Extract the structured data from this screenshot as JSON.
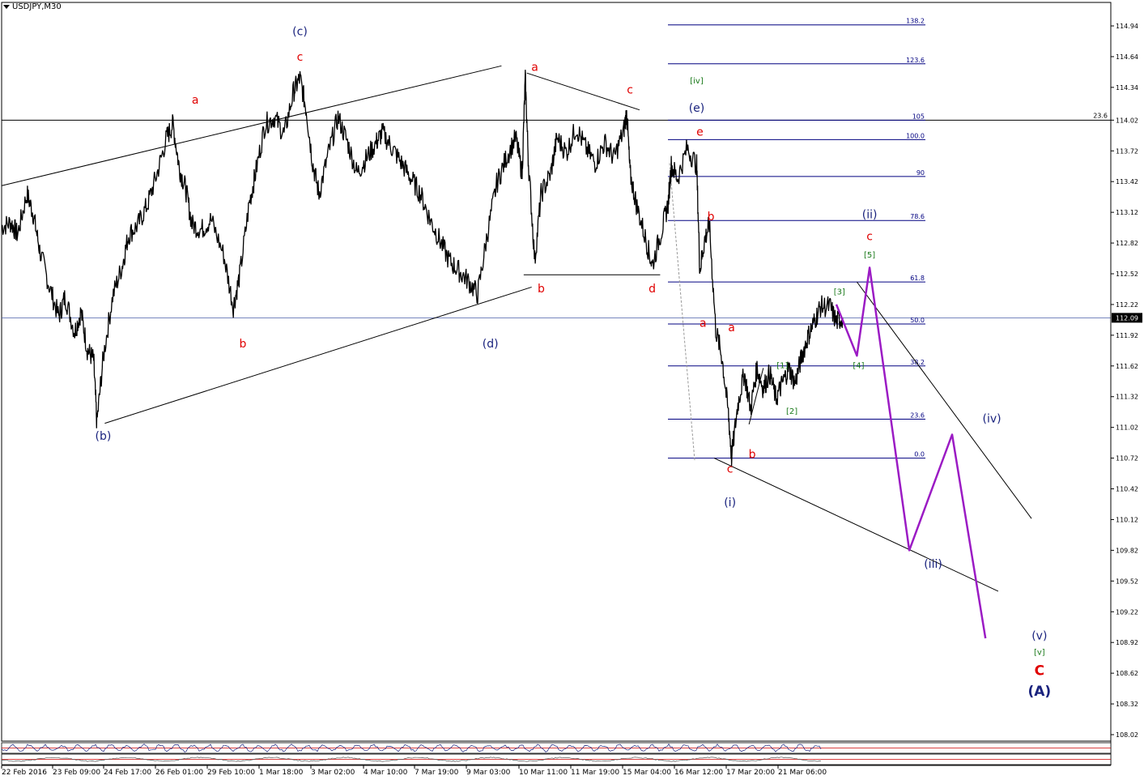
{
  "symbol": "USDJPY,M30",
  "colors": {
    "price": "#000000",
    "fib": "#000080",
    "projection": "#9b1bc4",
    "red_label": "#e00000",
    "blue_label": "#1a237e",
    "green_label": "#1b7a1b",
    "current_line": "#4a5fa8"
  },
  "chart_data": {
    "type": "line",
    "instrument": "USDJPY",
    "timeframe": "M30",
    "ylim": [
      108.02,
      115.0
    ],
    "yticks": [
      114.94,
      114.64,
      114.34,
      114.02,
      113.72,
      113.42,
      113.12,
      112.82,
      112.52,
      112.22,
      111.92,
      111.62,
      111.32,
      111.02,
      110.72,
      110.42,
      110.12,
      109.82,
      109.52,
      109.22,
      108.92,
      108.62,
      108.32,
      108.02
    ],
    "xticks": [
      "22 Feb 2016",
      "23 Feb 09:00",
      "24 Feb 17:00",
      "26 Feb 01:00",
      "29 Feb 10:00",
      "1 Mar 18:00",
      "3 Mar 02:00",
      "4 Mar 10:00",
      "7 Mar 19:00",
      "9 Mar 03:00",
      "10 Mar 11:00",
      "11 Mar 19:00",
      "15 Mar 04:00",
      "16 Mar 12:00",
      "17 Mar 20:00",
      "21 Mar 06:00"
    ],
    "price_path": [
      [
        0,
        112.98
      ],
      [
        0.3,
        113.02
      ],
      [
        0.5,
        112.9
      ],
      [
        0.8,
        113.3
      ],
      [
        1.0,
        113.1
      ],
      [
        1.2,
        112.75
      ],
      [
        1.5,
        112.4
      ],
      [
        1.8,
        112.1
      ],
      [
        2.0,
        112.3
      ],
      [
        2.3,
        111.95
      ],
      [
        2.5,
        112.15
      ],
      [
        2.7,
        111.78
      ],
      [
        2.9,
        111.68
      ],
      [
        3.0,
        111.06
      ],
      [
        3.2,
        111.7
      ],
      [
        3.5,
        112.3
      ],
      [
        3.8,
        112.6
      ],
      [
        4.0,
        112.9
      ],
      [
        4.3,
        113.0
      ],
      [
        4.6,
        113.2
      ],
      [
        4.9,
        113.5
      ],
      [
        5.2,
        113.85
      ],
      [
        5.4,
        113.98
      ],
      [
        5.6,
        113.55
      ],
      [
        5.8,
        113.35
      ],
      [
        6.0,
        113.0
      ],
      [
        6.3,
        112.95
      ],
      [
        6.6,
        113.05
      ],
      [
        7.0,
        112.7
      ],
      [
        7.3,
        112.2
      ],
      [
        7.5,
        112.5
      ],
      [
        7.8,
        113.2
      ],
      [
        8.0,
        113.5
      ],
      [
        8.3,
        113.98
      ],
      [
        8.6,
        114.05
      ],
      [
        8.9,
        113.88
      ],
      [
        9.2,
        114.3
      ],
      [
        9.4,
        114.43
      ],
      [
        9.6,
        114.12
      ],
      [
        9.8,
        113.6
      ],
      [
        10.0,
        113.3
      ],
      [
        10.3,
        113.7
      ],
      [
        10.6,
        114.05
      ],
      [
        10.9,
        113.8
      ],
      [
        11.2,
        113.5
      ],
      [
        11.5,
        113.65
      ],
      [
        11.8,
        113.8
      ],
      [
        12.0,
        113.9
      ],
      [
        12.3,
        113.75
      ],
      [
        12.6,
        113.6
      ],
      [
        12.9,
        113.45
      ],
      [
        13.2,
        113.3
      ],
      [
        13.5,
        113.05
      ],
      [
        13.8,
        112.85
      ],
      [
        14.1,
        112.65
      ],
      [
        14.4,
        112.55
      ],
      [
        14.7,
        112.45
      ],
      [
        15.0,
        112.32
      ],
      [
        15.3,
        112.9
      ],
      [
        15.6,
        113.4
      ],
      [
        15.9,
        113.65
      ],
      [
        16.2,
        113.85
      ],
      [
        16.4,
        113.5
      ],
      [
        16.5,
        114.42
      ],
      [
        16.6,
        113.6
      ],
      [
        16.8,
        112.65
      ],
      [
        17.0,
        113.3
      ],
      [
        17.3,
        113.5
      ],
      [
        17.5,
        113.85
      ],
      [
        17.8,
        113.7
      ],
      [
        18.1,
        113.95
      ],
      [
        18.4,
        113.75
      ],
      [
        18.7,
        113.6
      ],
      [
        19.0,
        113.8
      ],
      [
        19.3,
        113.65
      ],
      [
        19.6,
        113.92
      ],
      [
        19.7,
        114.1
      ],
      [
        19.8,
        113.5
      ],
      [
        20.0,
        113.2
      ],
      [
        20.3,
        112.85
      ],
      [
        20.5,
        112.6
      ],
      [
        20.8,
        112.95
      ],
      [
        21.0,
        113.2
      ],
      [
        21.1,
        113.58
      ],
      [
        21.3,
        113.45
      ],
      [
        21.6,
        113.75
      ],
      [
        21.9,
        113.58
      ],
      [
        22.0,
        112.55
      ],
      [
        22.15,
        112.85
      ],
      [
        22.3,
        113.0
      ],
      [
        22.5,
        111.98
      ],
      [
        22.7,
        111.7
      ],
      [
        22.9,
        111.15
      ],
      [
        23.0,
        110.73
      ],
      [
        23.2,
        111.25
      ],
      [
        23.4,
        111.55
      ],
      [
        23.6,
        111.2
      ],
      [
        23.8,
        111.6
      ],
      [
        24.0,
        111.4
      ],
      [
        24.2,
        111.55
      ],
      [
        24.4,
        111.3
      ],
      [
        24.6,
        111.45
      ],
      [
        24.8,
        111.6
      ],
      [
        25.0,
        111.45
      ],
      [
        25.2,
        111.7
      ],
      [
        25.4,
        111.9
      ],
      [
        25.6,
        112.05
      ],
      [
        25.8,
        112.2
      ],
      [
        26.1,
        112.2
      ],
      [
        26.3,
        112.05
      ],
      [
        26.5,
        112.09
      ]
    ],
    "fibonacci": [
      {
        "label": "138.2",
        "price": 114.95
      },
      {
        "label": "123.6",
        "price": 114.57
      },
      {
        "label": "105",
        "price": 114.02
      },
      {
        "label": "100.0",
        "price": 113.83
      },
      {
        "label": "90",
        "price": 113.47
      },
      {
        "label": "78.6",
        "price": 113.04
      },
      {
        "label": "61.8",
        "price": 112.44
      },
      {
        "label": "50.0",
        "price": 112.03
      },
      {
        "label": "38.2",
        "price": 111.62
      },
      {
        "label": "23.6",
        "price": 111.1
      },
      {
        "label": "0.0",
        "price": 110.72
      }
    ],
    "level_line": {
      "price": 114.02,
      "label": "23.6"
    },
    "current_price": {
      "label": "112.09",
      "price": 112.09
    },
    "projection_path": [
      [
        26.3,
        112.22
      ],
      [
        26.95,
        111.72
      ],
      [
        27.35,
        112.58
      ],
      [
        28.6,
        109.82
      ],
      [
        29.95,
        110.95
      ],
      [
        31.0,
        108.96
      ]
    ],
    "wave_labels": [
      {
        "text": "(c)",
        "x": 9.4,
        "y": 114.85,
        "color": "blue"
      },
      {
        "text": "c",
        "x": 9.4,
        "y": 114.6,
        "color": "red"
      },
      {
        "text": "a",
        "x": 6.1,
        "y": 114.18,
        "color": "red"
      },
      {
        "text": "b",
        "x": 7.6,
        "y": 111.8,
        "color": "red"
      },
      {
        "text": "(b)",
        "x": 3.2,
        "y": 110.9,
        "color": "blue"
      },
      {
        "text": "a",
        "x": 16.8,
        "y": 114.5,
        "color": "red"
      },
      {
        "text": "c",
        "x": 19.8,
        "y": 114.28,
        "color": "red"
      },
      {
        "text": "b",
        "x": 17.0,
        "y": 112.34,
        "color": "red"
      },
      {
        "text": "d",
        "x": 20.5,
        "y": 112.34,
        "color": "red"
      },
      {
        "text": "(d)",
        "x": 15.4,
        "y": 111.8,
        "color": "blue"
      },
      {
        "text": "[iv]",
        "x": 21.9,
        "y": 114.38,
        "color": "green"
      },
      {
        "text": "(e)",
        "x": 21.9,
        "y": 114.1,
        "color": "blue"
      },
      {
        "text": "e",
        "x": 22.0,
        "y": 113.87,
        "color": "red"
      },
      {
        "text": "b",
        "x": 22.35,
        "y": 113.04,
        "color": "red"
      },
      {
        "text": "a",
        "x": 22.1,
        "y": 112.0,
        "color": "red"
      },
      {
        "text": "a",
        "x": 23.0,
        "y": 111.96,
        "color": "red"
      },
      {
        "text": "c",
        "x": 22.95,
        "y": 110.58,
        "color": "red"
      },
      {
        "text": "b",
        "x": 23.65,
        "y": 110.72,
        "color": "red"
      },
      {
        "text": "(i)",
        "x": 22.95,
        "y": 110.25,
        "color": "blue"
      },
      {
        "text": "[1]",
        "x": 24.6,
        "y": 111.6,
        "color": "green"
      },
      {
        "text": "[2]",
        "x": 24.9,
        "y": 111.15,
        "color": "green"
      },
      {
        "text": "[3]",
        "x": 26.4,
        "y": 112.32,
        "color": "green"
      },
      {
        "text": "[4]",
        "x": 27.0,
        "y": 111.6,
        "color": "green"
      },
      {
        "text": "(ii)",
        "x": 27.35,
        "y": 113.06,
        "color": "blue"
      },
      {
        "text": "c",
        "x": 27.35,
        "y": 112.85,
        "color": "red"
      },
      {
        "text": "[5]",
        "x": 27.35,
        "y": 112.68,
        "color": "green"
      },
      {
        "text": "(iii)",
        "x": 29.35,
        "y": 109.65,
        "color": "blue"
      },
      {
        "text": "(iv)",
        "x": 31.2,
        "y": 111.07,
        "color": "blue"
      },
      {
        "text": "(v)",
        "x": 32.7,
        "y": 108.95,
        "color": "blue"
      },
      {
        "text": "[v]",
        "x": 32.7,
        "y": 108.8,
        "color": "green"
      },
      {
        "text": "C",
        "x": 32.7,
        "y": 108.6,
        "color": "red"
      },
      {
        "text": "(A)",
        "x": 32.7,
        "y": 108.4,
        "color": "blue"
      }
    ],
    "indicators": [
      "CCI",
      "MACD"
    ]
  }
}
